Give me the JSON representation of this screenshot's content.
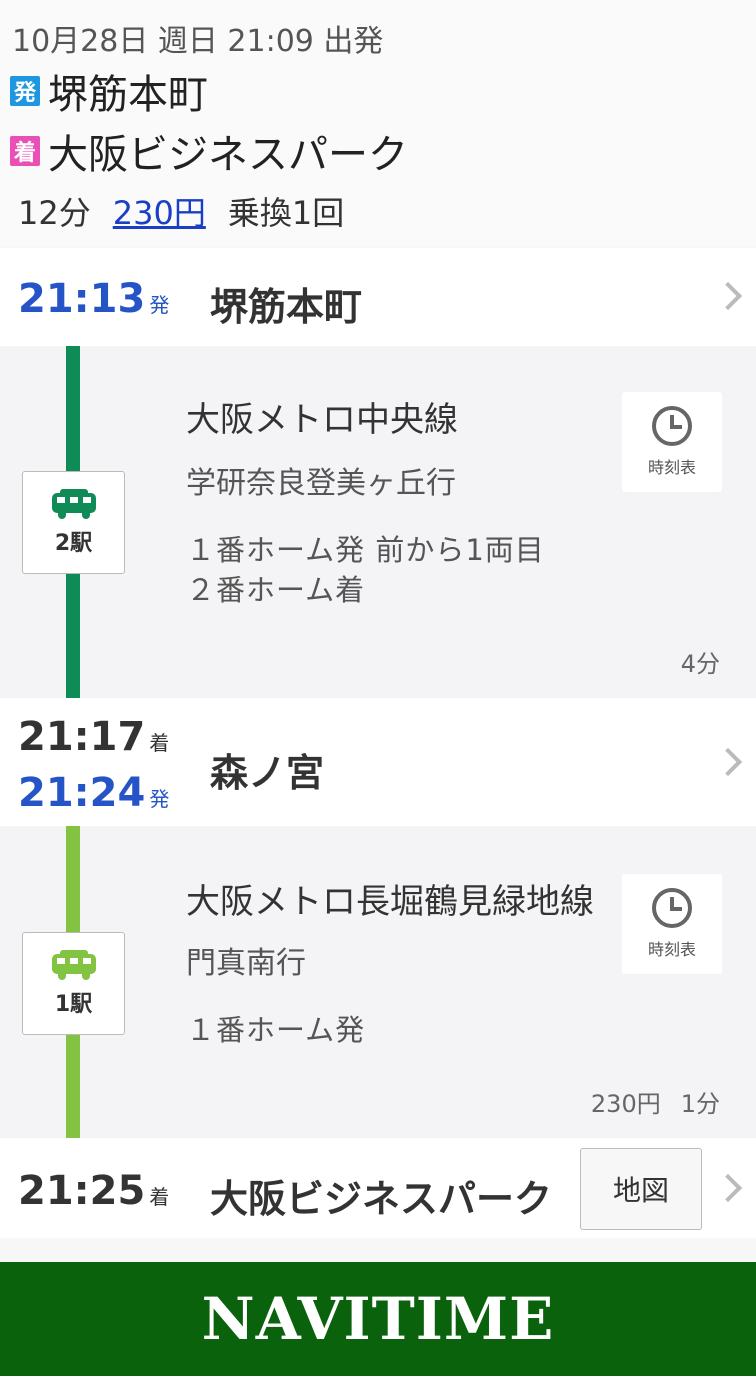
{
  "summary": {
    "datetime": "10月28日 週日 21:09 出発",
    "from_tag": "発",
    "from_station": "堺筋本町",
    "to_tag": "着",
    "to_station": "大阪ビジネスパーク",
    "duration": "12分",
    "fare": "230円",
    "transfers": "乗換1回"
  },
  "stations": [
    {
      "dep_time": "21:13",
      "dep_suffix": "発",
      "name": "堺筋本町"
    },
    {
      "arr_time": "21:17",
      "arr_suffix": "着",
      "dep_time": "21:24",
      "dep_suffix": "発",
      "name": "森ノ宮"
    },
    {
      "arr_time": "21:25",
      "arr_suffix": "着",
      "name": "大阪ビジネスパーク",
      "map_label": "地図"
    }
  ],
  "segments": [
    {
      "line": "大阪メトロ中央線",
      "destination": "学研奈良登美ヶ丘行",
      "stops": "2駅",
      "platform_lines": [
        "１番ホーム発 前から1両目",
        "２番ホーム着"
      ],
      "duration": "4分",
      "timetable_label": "時刻表",
      "color": "#0f8b57"
    },
    {
      "line": "大阪メトロ長堀鶴見緑地線",
      "destination": "門真南行",
      "stops": "1駅",
      "platform_lines": [
        "１番ホーム発"
      ],
      "fare": "230円",
      "duration": "1分",
      "timetable_label": "時刻表",
      "color": "#82c341"
    }
  ],
  "footer": {
    "logo": "NAVITIME",
    "bg_color": "#0a620d"
  }
}
